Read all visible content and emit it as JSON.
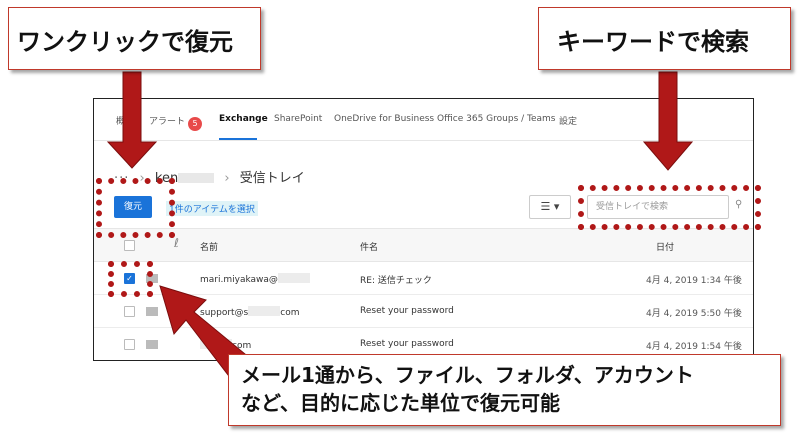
{
  "tabs": [
    {
      "label": "概"
    },
    {
      "label": "アラート",
      "badge": "5"
    },
    {
      "label": "Exchange"
    },
    {
      "label": "SharePoint"
    },
    {
      "label": "OneDrive for Business"
    },
    {
      "label": "Office 365 Groups / Teams"
    },
    {
      "label": "設定"
    }
  ],
  "breadcrumb": {
    "dots": "···",
    "user": "ken",
    "folder": "受信トレイ"
  },
  "toolbar": {
    "restore_label": "復元",
    "selected_label": "1件のアイテムを選択",
    "filter_glyph": "☰ ▾",
    "search_placeholder": "受信トレイで検索"
  },
  "table": {
    "headers": {
      "name": "名前",
      "subject": "件名",
      "date": "日付"
    },
    "rows": [
      {
        "name": "mari.miyakawa@",
        "name_suffix": "",
        "subject": "RE: 送信チェック",
        "date": "4月 4, 2019 1:34 午後",
        "checked": true
      },
      {
        "name": "support@s",
        "name_suffix": "com",
        "subject": "Reset your password",
        "date": "4月 4, 2019 5:50 午後",
        "checked": false
      },
      {
        "name": "",
        "name_suffix": "com",
        "subject": "Reset your password",
        "date": "4月 4, 2019 1:54 午後",
        "checked": false
      }
    ]
  },
  "callouts": {
    "one_click": "ワンクリックで復元",
    "keyword": "キーワードで検索",
    "granularity_line1": "メール1通から、ファイル、フォルダ、アカウント",
    "granularity_line2": "など、目的に応じた単位で復元可能"
  },
  "colors": {
    "accent": "#1a73d9",
    "highlight": "#b01818",
    "badge": "#e84a4a"
  }
}
